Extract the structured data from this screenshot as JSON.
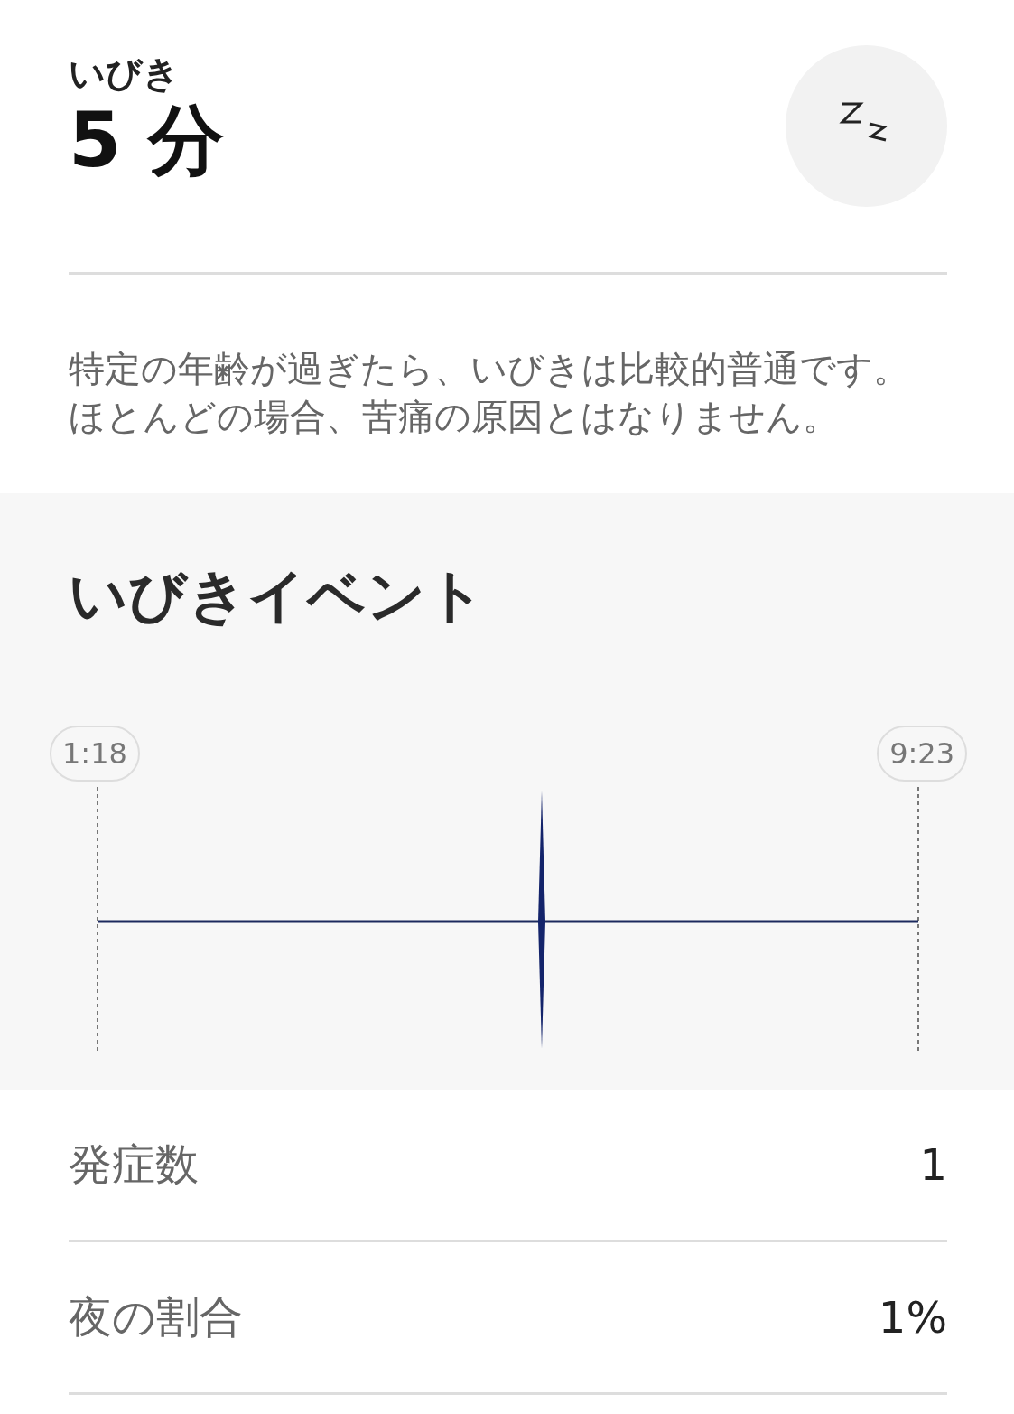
{
  "header": {
    "label": "いびき",
    "value": "5 分"
  },
  "description": "特定の年齢が過ぎたら、いびきは比較的普通です。ほとんどの場合、苦痛の原因とはなりません。",
  "events": {
    "title": "いびきイベント",
    "start_time": "1:18",
    "end_time": "9:23"
  },
  "stats": [
    {
      "label": "発症数",
      "value": "1"
    },
    {
      "label": "夜の割合",
      "value": "1%"
    }
  ]
}
